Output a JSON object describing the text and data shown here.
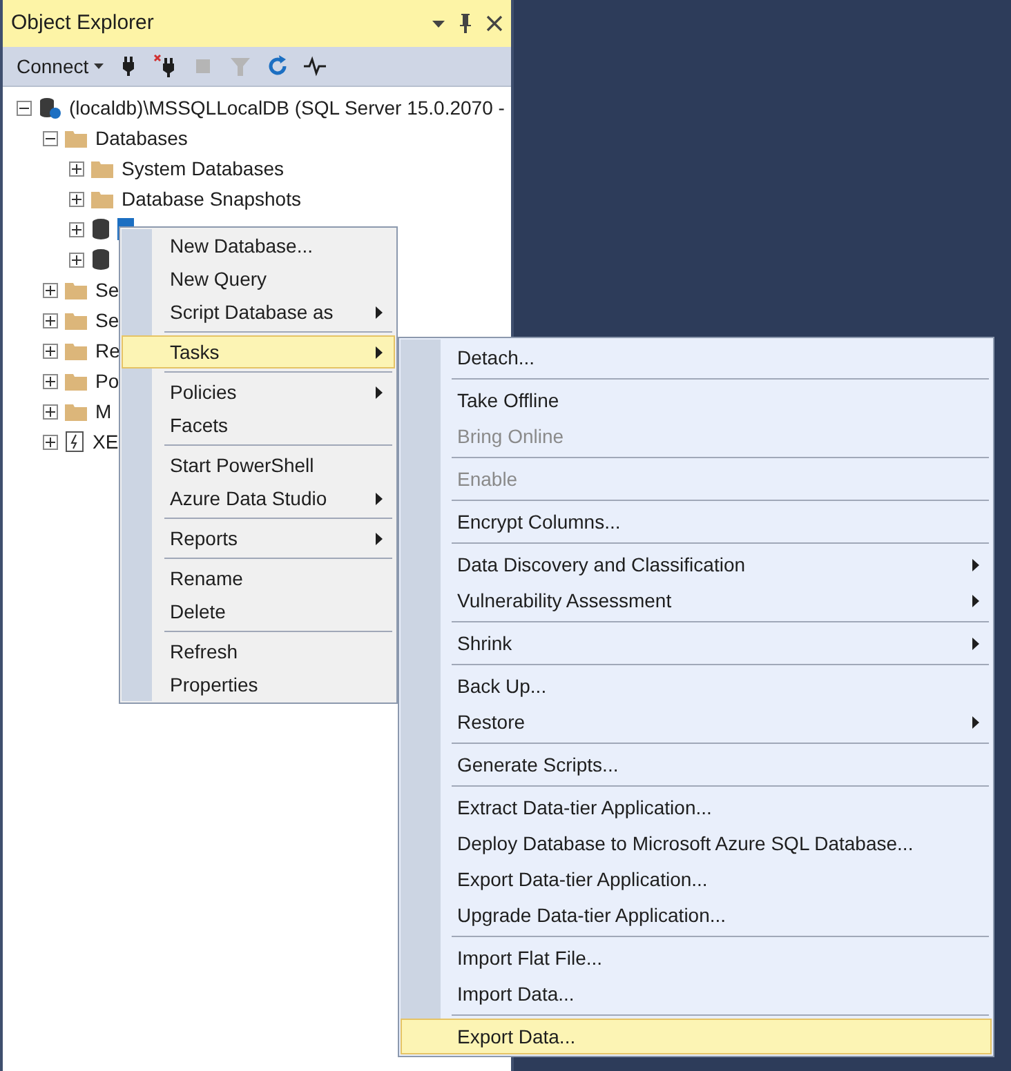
{
  "panel": {
    "title": "Object Explorer"
  },
  "toolbar": {
    "connect": "Connect",
    "tools": [
      {
        "kind": "plug",
        "disabled": false
      },
      {
        "kind": "unplug",
        "disabled": false
      },
      {
        "kind": "stop",
        "disabled": true
      },
      {
        "kind": "filter",
        "disabled": true
      },
      {
        "kind": "refresh",
        "disabled": false
      },
      {
        "kind": "activity",
        "disabled": false
      }
    ]
  },
  "tree": [
    {
      "label": "(localdb)\\MSSQLLocalDB (SQL Server 15.0.2070 -",
      "kind": "server",
      "expanded": true,
      "selected": false,
      "children": [
        {
          "label": "Databases",
          "kind": "folder",
          "expanded": true,
          "selected": false,
          "children": [
            {
              "label": "System Databases",
              "kind": "folder",
              "expanded": false,
              "selected": false
            },
            {
              "label": "Database Snapshots",
              "kind": "folder",
              "expanded": false,
              "selected": false
            },
            {
              "kind": "database",
              "expanded": false,
              "selected": true
            },
            {
              "kind": "database",
              "expanded": false,
              "selected": false
            }
          ]
        },
        {
          "label": "Se",
          "kind": "folder",
          "expanded": false,
          "selected": false
        },
        {
          "label": "Se",
          "kind": "folder",
          "expanded": false,
          "selected": false
        },
        {
          "label": "Re",
          "kind": "folder",
          "expanded": false,
          "selected": false
        },
        {
          "label": "Po",
          "kind": "folder",
          "expanded": false,
          "selected": false
        },
        {
          "label": "M",
          "kind": "folder",
          "expanded": false,
          "selected": false
        },
        {
          "label": "XE",
          "kind": "xevent",
          "expanded": false,
          "selected": false
        }
      ]
    }
  ],
  "context_menu": {
    "groups": [
      [
        {
          "label": "New Database...",
          "submenu": false,
          "disabled": false,
          "selected": false
        },
        {
          "label": "New Query",
          "submenu": false,
          "disabled": false,
          "selected": false
        },
        {
          "label": "Script Database as",
          "submenu": true,
          "disabled": false,
          "selected": false
        }
      ],
      [
        {
          "label": "Tasks",
          "submenu": true,
          "disabled": false,
          "selected": true
        }
      ],
      [
        {
          "label": "Policies",
          "submenu": true,
          "disabled": false,
          "selected": false
        },
        {
          "label": "Facets",
          "submenu": false,
          "disabled": false,
          "selected": false
        }
      ],
      [
        {
          "label": "Start PowerShell",
          "submenu": false,
          "disabled": false,
          "selected": false
        },
        {
          "label": "Azure Data Studio",
          "submenu": true,
          "disabled": false,
          "selected": false
        }
      ],
      [
        {
          "label": "Reports",
          "submenu": true,
          "disabled": false,
          "selected": false
        }
      ],
      [
        {
          "label": "Rename",
          "submenu": false,
          "disabled": false,
          "selected": false
        },
        {
          "label": "Delete",
          "submenu": false,
          "disabled": false,
          "selected": false
        }
      ],
      [
        {
          "label": "Refresh",
          "submenu": false,
          "disabled": false,
          "selected": false
        },
        {
          "label": "Properties",
          "submenu": false,
          "disabled": false,
          "selected": false
        }
      ]
    ]
  },
  "tasks_menu": {
    "groups": [
      [
        {
          "label": "Detach...",
          "submenu": false,
          "disabled": false,
          "selected": false
        }
      ],
      [
        {
          "label": "Take Offline",
          "submenu": false,
          "disabled": false,
          "selected": false
        },
        {
          "label": "Bring Online",
          "submenu": false,
          "disabled": true,
          "selected": false
        }
      ],
      [
        {
          "label": "Enable",
          "submenu": false,
          "disabled": true,
          "selected": false
        }
      ],
      [
        {
          "label": "Encrypt Columns...",
          "submenu": false,
          "disabled": false,
          "selected": false
        }
      ],
      [
        {
          "label": "Data Discovery and Classification",
          "submenu": true,
          "disabled": false,
          "selected": false
        },
        {
          "label": "Vulnerability Assessment",
          "submenu": true,
          "disabled": false,
          "selected": false
        }
      ],
      [
        {
          "label": "Shrink",
          "submenu": true,
          "disabled": false,
          "selected": false
        }
      ],
      [
        {
          "label": "Back Up...",
          "submenu": false,
          "disabled": false,
          "selected": false
        },
        {
          "label": "Restore",
          "submenu": true,
          "disabled": false,
          "selected": false
        }
      ],
      [
        {
          "label": "Generate Scripts...",
          "submenu": false,
          "disabled": false,
          "selected": false
        }
      ],
      [
        {
          "label": "Extract Data-tier Application...",
          "submenu": false,
          "disabled": false,
          "selected": false
        },
        {
          "label": "Deploy Database to Microsoft Azure SQL Database...",
          "submenu": false,
          "disabled": false,
          "selected": false
        },
        {
          "label": "Export Data-tier Application...",
          "submenu": false,
          "disabled": false,
          "selected": false
        },
        {
          "label": "Upgrade Data-tier Application...",
          "submenu": false,
          "disabled": false,
          "selected": false
        }
      ],
      [
        {
          "label": "Import Flat File...",
          "submenu": false,
          "disabled": false,
          "selected": false
        },
        {
          "label": "Import Data...",
          "submenu": false,
          "disabled": false,
          "selected": false
        }
      ],
      [
        {
          "label": "Export Data...",
          "submenu": false,
          "disabled": false,
          "selected": true
        }
      ]
    ]
  }
}
